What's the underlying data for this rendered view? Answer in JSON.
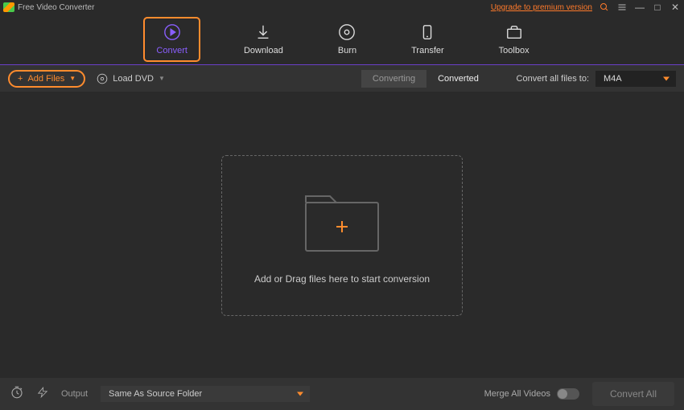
{
  "titlebar": {
    "app_title": "Free Video Converter",
    "upgrade_text": "Upgrade to premium version"
  },
  "nav": {
    "convert": "Convert",
    "download": "Download",
    "burn": "Burn",
    "transfer": "Transfer",
    "toolbox": "Toolbox"
  },
  "toolbar": {
    "add_files": "Add Files",
    "load_dvd": "Load DVD",
    "converting": "Converting",
    "converted": "Converted",
    "convert_to_label": "Convert all files to:",
    "format": "M4A"
  },
  "drop": {
    "text": "Add or Drag files here to start conversion"
  },
  "bottom": {
    "output_label": "Output",
    "output_value": "Same As Source Folder",
    "merge_label": "Merge All Videos",
    "convert_all": "Convert All"
  }
}
